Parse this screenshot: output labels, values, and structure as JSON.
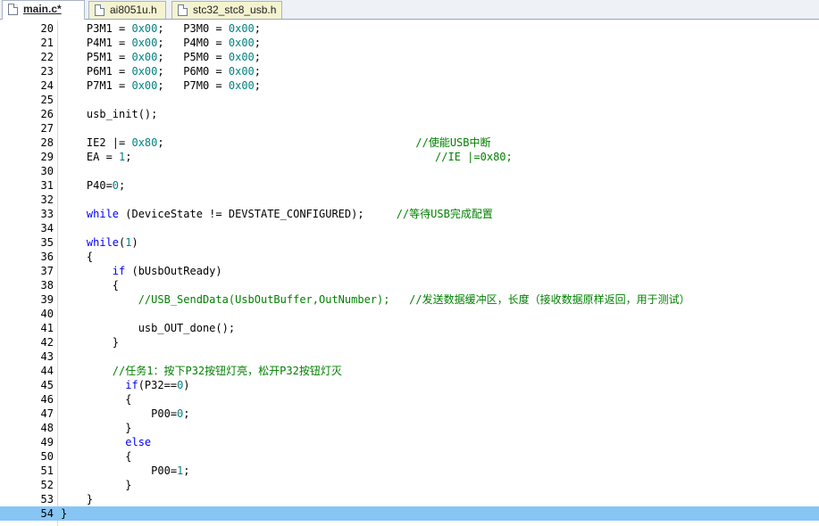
{
  "tabs": [
    {
      "label": "main.c*",
      "active": true
    },
    {
      "label": "ai8051u.h",
      "active": false
    },
    {
      "label": "stc32_stc8_usb.h",
      "active": false
    }
  ],
  "colors": {
    "keyword": "#0000ff",
    "number": "#008080",
    "comment": "#008000",
    "current_line": "#87c5f5"
  },
  "editor": {
    "current_line": 54,
    "lines": [
      {
        "n": "20",
        "segs": [
          [
            "t",
            "    P3M1 = "
          ],
          [
            "num",
            "0x00"
          ],
          [
            "t",
            ";   P3M0 = "
          ],
          [
            "num",
            "0x00"
          ],
          [
            "t",
            ";"
          ]
        ]
      },
      {
        "n": "21",
        "segs": [
          [
            "t",
            "    P4M1 = "
          ],
          [
            "num",
            "0x00"
          ],
          [
            "t",
            ";   P4M0 = "
          ],
          [
            "num",
            "0x00"
          ],
          [
            "t",
            ";"
          ]
        ]
      },
      {
        "n": "22",
        "segs": [
          [
            "t",
            "    P5M1 = "
          ],
          [
            "num",
            "0x00"
          ],
          [
            "t",
            ";   P5M0 = "
          ],
          [
            "num",
            "0x00"
          ],
          [
            "t",
            ";"
          ]
        ]
      },
      {
        "n": "23",
        "segs": [
          [
            "t",
            "    P6M1 = "
          ],
          [
            "num",
            "0x00"
          ],
          [
            "t",
            ";   P6M0 = "
          ],
          [
            "num",
            "0x00"
          ],
          [
            "t",
            ";"
          ]
        ]
      },
      {
        "n": "24",
        "segs": [
          [
            "t",
            "    P7M1 = "
          ],
          [
            "num",
            "0x00"
          ],
          [
            "t",
            ";   P7M0 = "
          ],
          [
            "num",
            "0x00"
          ],
          [
            "t",
            ";"
          ]
        ]
      },
      {
        "n": "25",
        "segs": []
      },
      {
        "n": "26",
        "segs": [
          [
            "t",
            "    usb_init();"
          ]
        ]
      },
      {
        "n": "27",
        "segs": []
      },
      {
        "n": "28",
        "segs": [
          [
            "t",
            "    IE2 |= "
          ],
          [
            "num",
            "0x80"
          ],
          [
            "t",
            ";                                       "
          ],
          [
            "cm",
            "//使能USB中断"
          ]
        ]
      },
      {
        "n": "29",
        "segs": [
          [
            "t",
            "    EA = "
          ],
          [
            "num",
            "1"
          ],
          [
            "t",
            ";                                               "
          ],
          [
            "cm",
            "//IE |=0x80;"
          ]
        ]
      },
      {
        "n": "30",
        "segs": []
      },
      {
        "n": "31",
        "segs": [
          [
            "t",
            "    P40="
          ],
          [
            "num",
            "0"
          ],
          [
            "t",
            ";"
          ]
        ]
      },
      {
        "n": "32",
        "segs": []
      },
      {
        "n": "33",
        "segs": [
          [
            "t",
            "    "
          ],
          [
            "kw",
            "while"
          ],
          [
            "t",
            " (DeviceState != DEVSTATE_CONFIGURED);     "
          ],
          [
            "cm",
            "//等待USB完成配置"
          ]
        ]
      },
      {
        "n": "34",
        "segs": []
      },
      {
        "n": "35",
        "segs": [
          [
            "t",
            "    "
          ],
          [
            "kw",
            "while"
          ],
          [
            "t",
            "("
          ],
          [
            "num",
            "1"
          ],
          [
            "t",
            ")"
          ]
        ]
      },
      {
        "n": "36",
        "segs": [
          [
            "t",
            "    {"
          ]
        ]
      },
      {
        "n": "37",
        "segs": [
          [
            "t",
            "        "
          ],
          [
            "kw",
            "if"
          ],
          [
            "t",
            " (bUsbOutReady)"
          ]
        ]
      },
      {
        "n": "38",
        "segs": [
          [
            "t",
            "        {"
          ]
        ]
      },
      {
        "n": "39",
        "segs": [
          [
            "t",
            "            "
          ],
          [
            "cm",
            "//USB_SendData(UsbOutBuffer,OutNumber);   //发送数据缓冲区，长度（接收数据原样返回，用于测试）"
          ]
        ]
      },
      {
        "n": "40",
        "segs": []
      },
      {
        "n": "41",
        "segs": [
          [
            "t",
            "            usb_OUT_done();"
          ]
        ]
      },
      {
        "n": "42",
        "segs": [
          [
            "t",
            "        }"
          ]
        ]
      },
      {
        "n": "43",
        "segs": []
      },
      {
        "n": "44",
        "segs": [
          [
            "t",
            "        "
          ],
          [
            "cm",
            "//任务1：按下P32按钮灯亮，松开P32按钮灯灭"
          ]
        ]
      },
      {
        "n": "45",
        "segs": [
          [
            "t",
            "          "
          ],
          [
            "kw",
            "if"
          ],
          [
            "t",
            "(P32=="
          ],
          [
            "num",
            "0"
          ],
          [
            "t",
            ")"
          ]
        ]
      },
      {
        "n": "46",
        "segs": [
          [
            "t",
            "          {"
          ]
        ]
      },
      {
        "n": "47",
        "segs": [
          [
            "t",
            "              P00="
          ],
          [
            "num",
            "0"
          ],
          [
            "t",
            ";"
          ]
        ]
      },
      {
        "n": "48",
        "segs": [
          [
            "t",
            "          }"
          ]
        ]
      },
      {
        "n": "49",
        "segs": [
          [
            "t",
            "          "
          ],
          [
            "kw",
            "else"
          ]
        ]
      },
      {
        "n": "50",
        "segs": [
          [
            "t",
            "          {"
          ]
        ]
      },
      {
        "n": "51",
        "segs": [
          [
            "t",
            "              P00="
          ],
          [
            "num",
            "1"
          ],
          [
            "t",
            ";"
          ]
        ]
      },
      {
        "n": "52",
        "segs": [
          [
            "t",
            "          }"
          ]
        ]
      },
      {
        "n": "53",
        "segs": [
          [
            "t",
            "    }"
          ]
        ]
      },
      {
        "n": "54",
        "segs": [
          [
            "t",
            "}"
          ]
        ]
      }
    ]
  }
}
